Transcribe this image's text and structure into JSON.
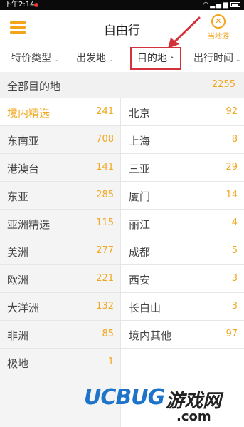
{
  "status_bar": {
    "time": "下午2:14"
  },
  "header": {
    "title": "自由行",
    "local_tour_label": "当地游",
    "menu_icon": "hamburger-menu-icon"
  },
  "filters": [
    {
      "label": "特价类型",
      "active": false
    },
    {
      "label": "出发地",
      "active": false
    },
    {
      "label": "目的地",
      "active": true
    },
    {
      "label": "出行时间",
      "active": false
    }
  ],
  "all_destinations": {
    "label": "全部目的地",
    "count": "2255"
  },
  "regions": [
    {
      "name": "境内精选",
      "count": "241",
      "selected": true
    },
    {
      "name": "东南亚",
      "count": "708"
    },
    {
      "name": "港澳台",
      "count": "141"
    },
    {
      "name": "东亚",
      "count": "285"
    },
    {
      "name": "亚洲精选",
      "count": "115"
    },
    {
      "name": "美洲",
      "count": "277"
    },
    {
      "name": "欧洲",
      "count": "221"
    },
    {
      "name": "大洋洲",
      "count": "132"
    },
    {
      "name": "非洲",
      "count": "85"
    },
    {
      "name": "极地",
      "count": "1"
    }
  ],
  "cities": [
    {
      "name": "北京",
      "count": "92"
    },
    {
      "name": "上海",
      "count": "8"
    },
    {
      "name": "三亚",
      "count": "29"
    },
    {
      "name": "厦门",
      "count": "14"
    },
    {
      "name": "丽江",
      "count": "4"
    },
    {
      "name": "成都",
      "count": "5"
    },
    {
      "name": "西安",
      "count": "3"
    },
    {
      "name": "长白山",
      "count": "3"
    },
    {
      "name": "境内其他",
      "count": "97"
    }
  ],
  "watermark": {
    "brand": "UCBUG",
    "cn": "游戏网",
    "domain": ".com"
  },
  "colors": {
    "accent": "#f0a820",
    "annotation": "#d3323a",
    "watermark_blue": "#1d74c9"
  }
}
